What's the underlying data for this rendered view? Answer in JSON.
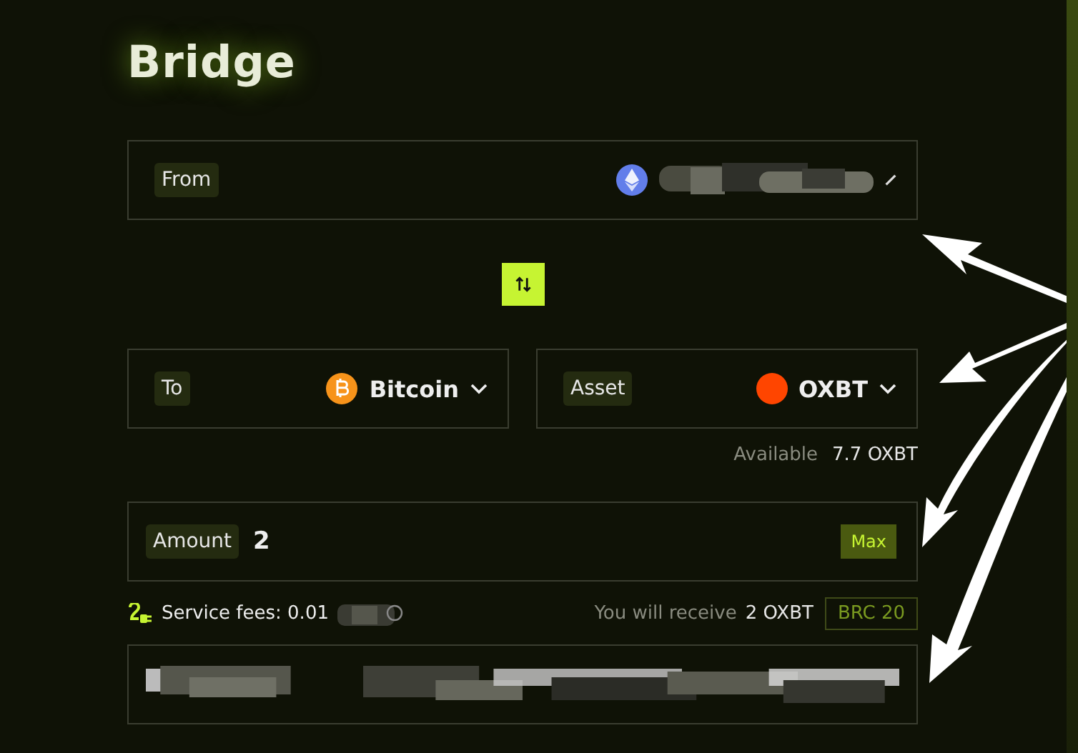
{
  "title": "Bridge",
  "from": {
    "label": "From"
  },
  "to": {
    "label": "To",
    "network": "Bitcoin"
  },
  "asset": {
    "label": "Asset",
    "symbol": "OXBT"
  },
  "available": {
    "label": "Available",
    "value": "7.7 OXBT"
  },
  "amount": {
    "label": "Amount",
    "value": "2",
    "action": "Max"
  },
  "fees": {
    "text": "Service fees: 0.01"
  },
  "receive": {
    "label": "You will receive",
    "value": "2 OXBT",
    "standard": "BRC 20"
  }
}
